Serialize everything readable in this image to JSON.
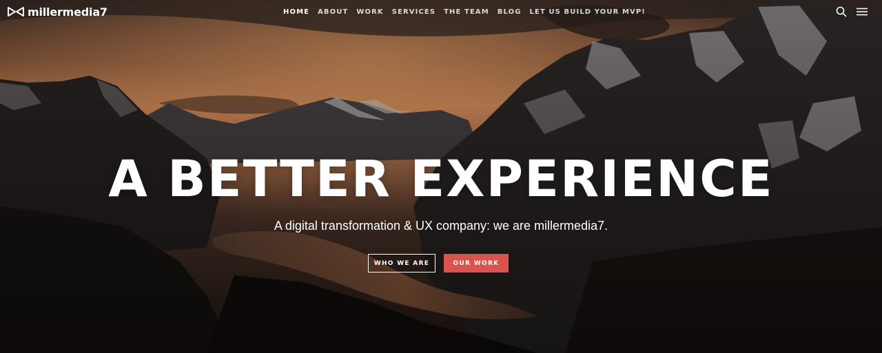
{
  "header": {
    "logo_text": "millermedia7",
    "nav": [
      {
        "label": "HOME",
        "active": true
      },
      {
        "label": "ABOUT",
        "active": false
      },
      {
        "label": "WORK",
        "active": false
      },
      {
        "label": "SERVICES",
        "active": false
      },
      {
        "label": "THE TEAM",
        "active": false
      },
      {
        "label": "BLOG",
        "active": false
      },
      {
        "label": "LET US BUILD YOUR MVP!",
        "active": false
      }
    ],
    "icons": {
      "search": "search-icon",
      "menu": "hamburger-menu-icon",
      "logo": "bowtie-logo-icon"
    }
  },
  "hero": {
    "headline": "A BETTER EXPERIENCE",
    "subtitle": "A digital transformation & UX company: we are millermedia7.",
    "buttons": {
      "primary": "WHO WE ARE",
      "secondary": "OUR WORK"
    }
  },
  "colors": {
    "accent": "#d9534f",
    "text": "#ffffff",
    "sky_glow": "#e0915a"
  }
}
